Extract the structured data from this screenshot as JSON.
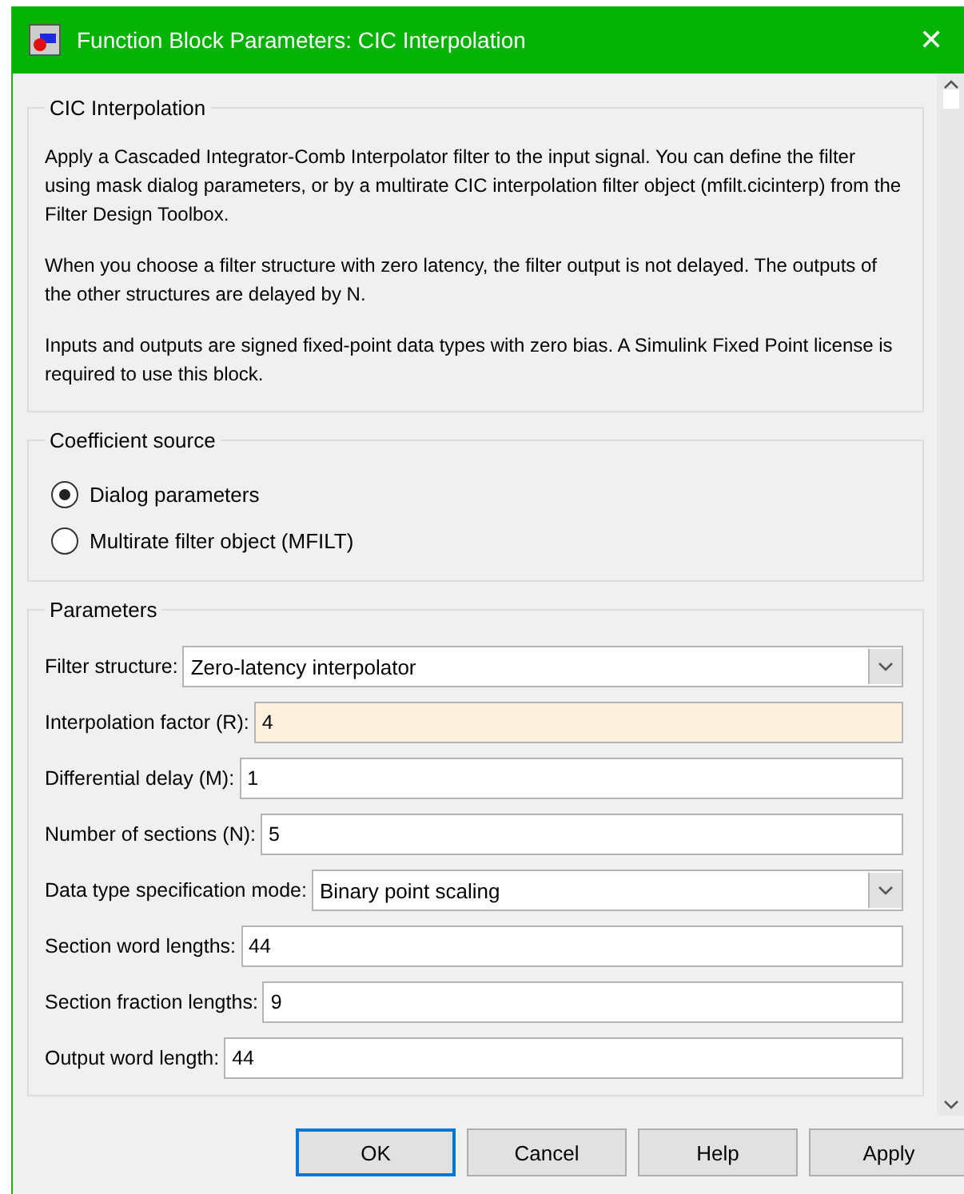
{
  "window": {
    "title": "Function Block Parameters: CIC Interpolation",
    "close": "✕"
  },
  "description": {
    "legend": "CIC Interpolation",
    "paragraphs": [
      "Apply a Cascaded Integrator-Comb Interpolator filter to the input signal. You can define the filter using mask dialog parameters, or by a multirate CIC interpolation filter object (mfilt.cicinterp) from the Filter Design Toolbox.",
      "When you choose a filter structure with zero latency, the filter output is not delayed. The outputs of the other structures are delayed by N.",
      "Inputs and outputs are signed fixed-point data types with zero bias.  A Simulink Fixed Point license is required to use this block."
    ]
  },
  "coefficient_source": {
    "legend": "Coefficient source",
    "options": [
      {
        "label": "Dialog parameters",
        "selected": true
      },
      {
        "label": "Multirate filter object (MFILT)",
        "selected": false
      }
    ]
  },
  "parameters": {
    "legend": "Parameters",
    "fields": [
      {
        "kind": "dropdown",
        "label": "Filter structure:",
        "value": "Zero-latency interpolator"
      },
      {
        "kind": "text",
        "label": "Interpolation factor (R):",
        "value": "4",
        "highlighted": true
      },
      {
        "kind": "text",
        "label": "Differential delay (M):",
        "value": "1",
        "highlighted": false
      },
      {
        "kind": "text",
        "label": "Number of sections (N):",
        "value": "5",
        "highlighted": false
      },
      {
        "kind": "dropdown",
        "label": "Data type specification mode:",
        "value": "Binary point scaling"
      },
      {
        "kind": "text",
        "label": "Section word lengths:",
        "value": "44",
        "highlighted": false
      },
      {
        "kind": "text",
        "label": "Section fraction lengths:",
        "value": "9",
        "highlighted": false
      },
      {
        "kind": "text",
        "label": "Output word length:",
        "value": "44",
        "highlighted": false
      }
    ]
  },
  "buttons": [
    {
      "label": "OK",
      "default": true
    },
    {
      "label": "Cancel",
      "default": false
    },
    {
      "label": "Help",
      "default": false
    },
    {
      "label": "Apply",
      "default": false
    }
  ]
}
